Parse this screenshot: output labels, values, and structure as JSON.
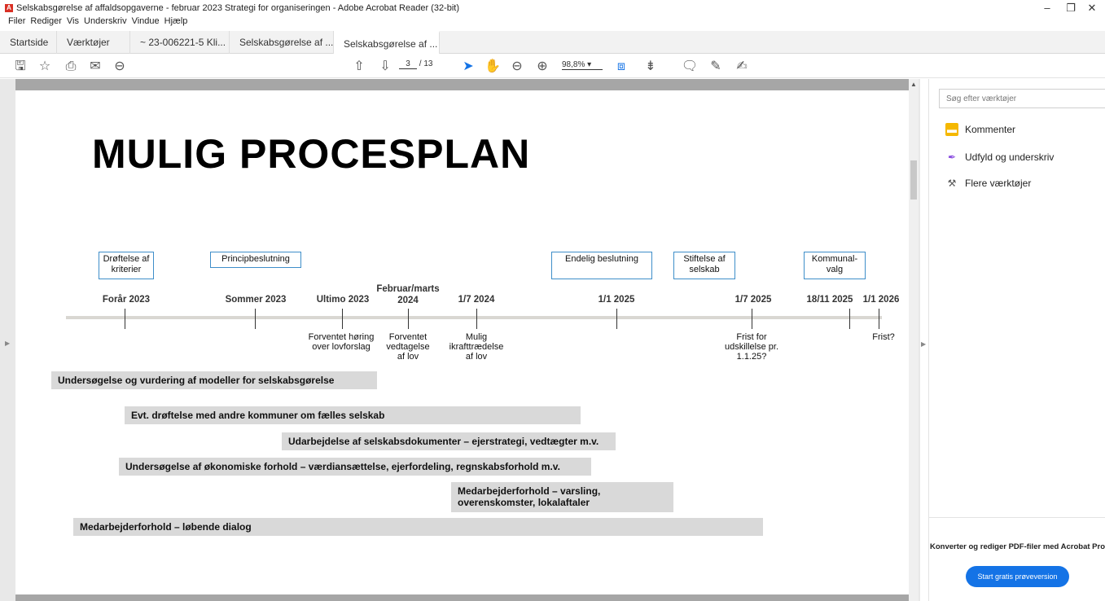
{
  "window": {
    "title": "Selskabsgørelse af affaldsopgaverne - februar 2023 Strategi for organiseringen - Adobe Acrobat Reader (32-bit)",
    "minimize_glyph": "–",
    "restore_glyph": "❐",
    "close_glyph": "✕"
  },
  "menu": [
    "Filer",
    "Rediger",
    "Vis",
    "Underskriv",
    "Vindue",
    "Hjælp"
  ],
  "tabs": [
    {
      "label": "Startside"
    },
    {
      "label": "Værktøjer"
    },
    {
      "label": "~ 23-006221-5 Kli..."
    },
    {
      "label": "Selskabsgørelse af ..."
    },
    {
      "label": "Selskabsgørelse af ...",
      "close": "×"
    }
  ],
  "toolbar": {
    "page_current": "3",
    "page_total": "/ 13",
    "zoom": "98,8%"
  },
  "document": {
    "title": "MULIG PROCESPLAN",
    "milestone_boxes": [
      "Drøftelse af kriterier",
      "Principbeslutning",
      "Endelig beslutning",
      "Stiftelse af selskab",
      "Kommunal-valg"
    ],
    "dates": [
      "Forår 2023",
      "Sommer 2023",
      "Ultimo 2023",
      "Februar/marts 2024",
      "1/7 2024",
      "1/1 2025",
      "1/7 2025",
      "18/11 2025",
      "1/1 2026"
    ],
    "notes": [
      "Forventet høring over lovforslag",
      "Forventet vedtagelse af lov",
      "Mulig ikrafttrædelse af lov",
      "Frist for udskillelse pr. 1.1.25?",
      "Frist?"
    ],
    "bars": [
      "Undersøgelse og vurdering af modeller for selskabsgørelse",
      "Evt. drøftelse med andre kommuner om fælles selskab",
      "Udarbejdelse af selskabsdokumenter – ejerstrategi, vedtægter m.v.",
      "Undersøgelse af økonomiske forhold – værdiansættelse, ejerfordeling, regnskabsforhold m.v.",
      "Medarbejderforhold – varsling, overenskomster, lokalaftaler",
      "Medarbejderforhold – løbende dialog"
    ]
  },
  "right_panel": {
    "search_placeholder": "Søg efter værktøjer",
    "tools": [
      "Kommenter",
      "Udfyld og underskriv",
      "Flere værktøjer"
    ],
    "promo_text": "Konverter og rediger PDF-filer med Acrobat Pro",
    "promo_button": "Start gratis prøveversion"
  }
}
